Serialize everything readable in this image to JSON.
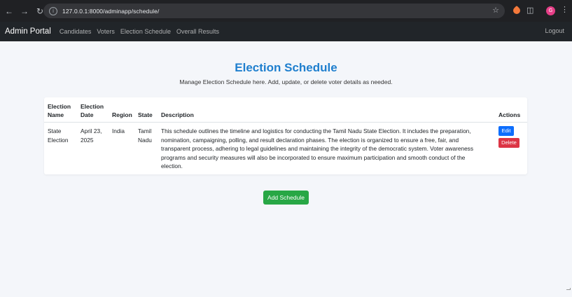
{
  "browser": {
    "url": "127.0.0.1:8000/adminapp/schedule/",
    "profile_initial": "G"
  },
  "navbar": {
    "brand": "Admin Portal",
    "links": [
      "Candidates",
      "Voters",
      "Election Schedule",
      "Overall Results"
    ],
    "logout": "Logout"
  },
  "page": {
    "title": "Election Schedule",
    "subtitle": "Manage Election Schedule here. Add, update, or delete voter details as needed."
  },
  "table": {
    "headers": {
      "name_line1": "Election",
      "name_line2": "Name",
      "date_line1": "Election",
      "date_line2": "Date",
      "region": "Region",
      "state": "State",
      "description": "Description",
      "actions": "Actions"
    },
    "rows": [
      {
        "name_line1": "State",
        "name_line2": "Election",
        "date_line1": "April 23,",
        "date_line2": "2025",
        "region": "India",
        "state_line1": "Tamil",
        "state_line2": "Nadu",
        "description_lines": [
          "This schedule outlines the timeline and logistics for conducting the Tamil Nadu State Election. It includes the preparation,",
          "nomination, campaigning, polling, and result declaration phases. The election is organized to ensure a free, fair, and",
          "transparent process, adhering to legal guidelines and maintaining the integrity of the democratic system. Voter awareness",
          "programs and security measures will also be incorporated to ensure maximum participation and smooth conduct of the",
          "election."
        ],
        "edit_label": "Edit",
        "delete_label": "Delete"
      }
    ]
  },
  "add_button": "Add Schedule",
  "colors": {
    "title": "#1f7fce",
    "edit": "#0d6efd",
    "delete": "#dc3545",
    "add": "#28a745",
    "navbar": "#212529"
  }
}
